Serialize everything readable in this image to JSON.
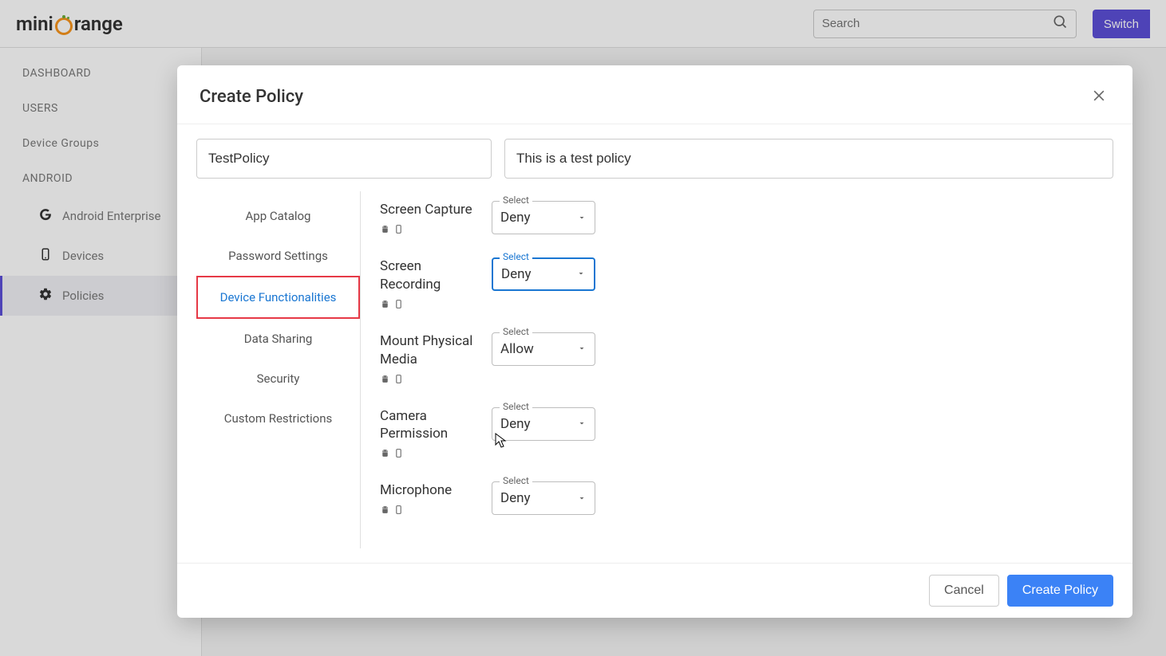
{
  "header": {
    "logo_prefix": "mini",
    "logo_suffix": "range",
    "search_placeholder": "Search",
    "switch_label": "Switch"
  },
  "sidebar": {
    "items": [
      {
        "label": "DASHBOARD"
      },
      {
        "label": "USERS"
      },
      {
        "label": "Device Groups"
      },
      {
        "label": "ANDROID"
      },
      {
        "label": "Android Enterprise"
      },
      {
        "label": "Devices"
      },
      {
        "label": "Policies"
      }
    ]
  },
  "modal": {
    "title": "Create Policy",
    "name_value": "TestPolicy",
    "desc_value": "This is a test policy",
    "tabs": [
      "App Catalog",
      "Password Settings",
      "Device Functionalities",
      "Data Sharing",
      "Security",
      "Custom Restrictions"
    ],
    "select_label": "Select",
    "settings": [
      {
        "label": "Screen Capture",
        "value": "Deny"
      },
      {
        "label": "Screen Recording",
        "value": "Deny",
        "focused": true
      },
      {
        "label": "Mount Physical Media",
        "value": "Allow"
      },
      {
        "label": "Camera Permission",
        "value": "Deny"
      },
      {
        "label": "Microphone",
        "value": "Deny"
      }
    ],
    "cancel_label": "Cancel",
    "submit_label": "Create Policy"
  }
}
